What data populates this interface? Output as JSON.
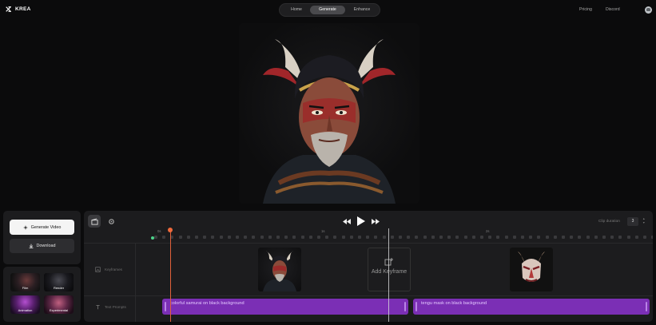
{
  "app": {
    "brand": "KREA",
    "nav": [
      {
        "label": "Home",
        "active": false
      },
      {
        "label": "Generate",
        "active": true
      },
      {
        "label": "Enhance",
        "active": false
      }
    ],
    "top_links": [
      "Pricing",
      "Discord"
    ]
  },
  "left_panel": {
    "generate_label": "Generate Video",
    "download_label": "Download",
    "presets": [
      "Film",
      "Render",
      "Animation",
      "Experimental"
    ]
  },
  "timeline": {
    "clip_duration_label": "Clip duration",
    "clip_duration_value": "3",
    "ruler_labels": [
      "0s",
      "1s",
      "2s"
    ],
    "rows": {
      "keyframes": "Keyframes",
      "text_prompts": "Text Prompts"
    },
    "add_keyframe_label": "Add Keyframe",
    "prompts": [
      "colorful samurai on black background",
      "tengu mask on black background"
    ]
  },
  "colors": {
    "accent_purple": "#7b2fb5",
    "playhead": "#ef6a3c",
    "indicator": "#4cd38a"
  },
  "icons": [
    "krea-logo-icon",
    "user-avatar-icon",
    "sparkle-icon",
    "download-icon",
    "clapper-icon",
    "gear-icon",
    "rewind-icon",
    "play-icon",
    "fast-forward-icon",
    "image-icon",
    "text-icon",
    "add-image-icon"
  ]
}
